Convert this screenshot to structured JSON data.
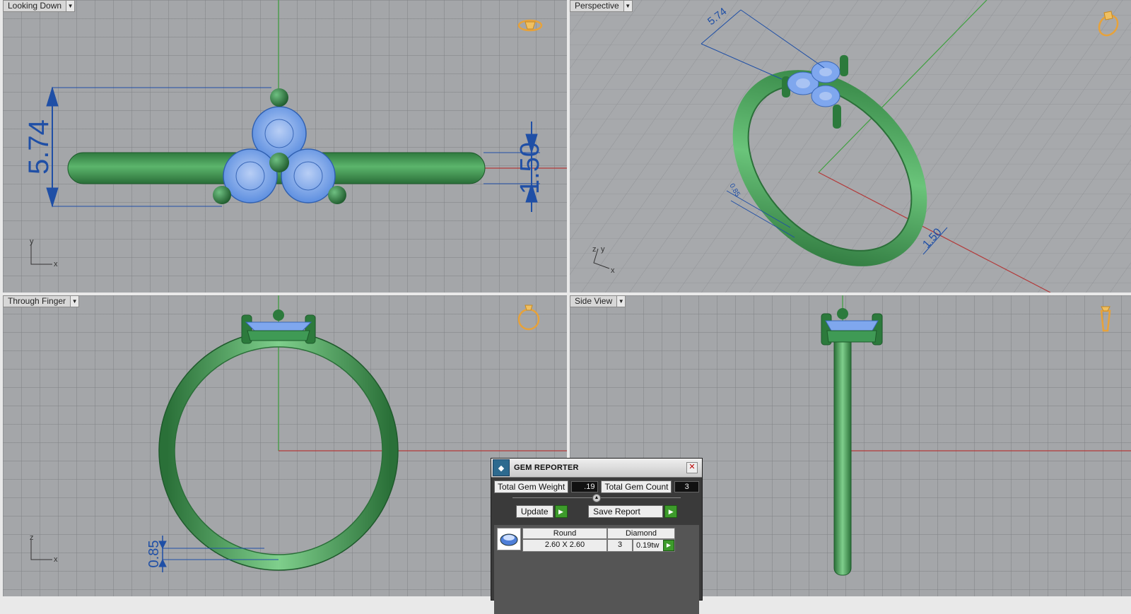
{
  "viewports": {
    "top": {
      "label": "Looking Down",
      "axis_v": "y",
      "axis_h": "x"
    },
    "persp": {
      "label": "Perspective",
      "axis_v": "y",
      "axis_z": "z",
      "axis_h": "x"
    },
    "front": {
      "label": "Through Finger",
      "axis_v": "z",
      "axis_h": "x"
    },
    "right": {
      "label": "Side View"
    }
  },
  "dimensions": {
    "top_height": "5.74",
    "top_width": "1.50",
    "persp_length": "5.74",
    "persp_thick": "0.85",
    "persp_width": "1.50",
    "front_thick": "0.85"
  },
  "gem_reporter": {
    "title": "GEM REPORTER",
    "total_weight_label": "Total Gem Weight",
    "total_weight_value": ".19",
    "total_count_label": "Total Gem Count",
    "total_count_value": "3",
    "update_label": "Update",
    "save_label": "Save Report",
    "row": {
      "shape": "Round",
      "size": "2.60 X 2.60",
      "material": "Diamond",
      "count": "3",
      "weight": "0.19tw"
    }
  },
  "colors": {
    "ring": "#3f9a55",
    "gem": "#6f9fe8",
    "dimension": "#1f4fa6",
    "axis_x": "#b33a3a",
    "axis_y": "#3ea03e"
  }
}
